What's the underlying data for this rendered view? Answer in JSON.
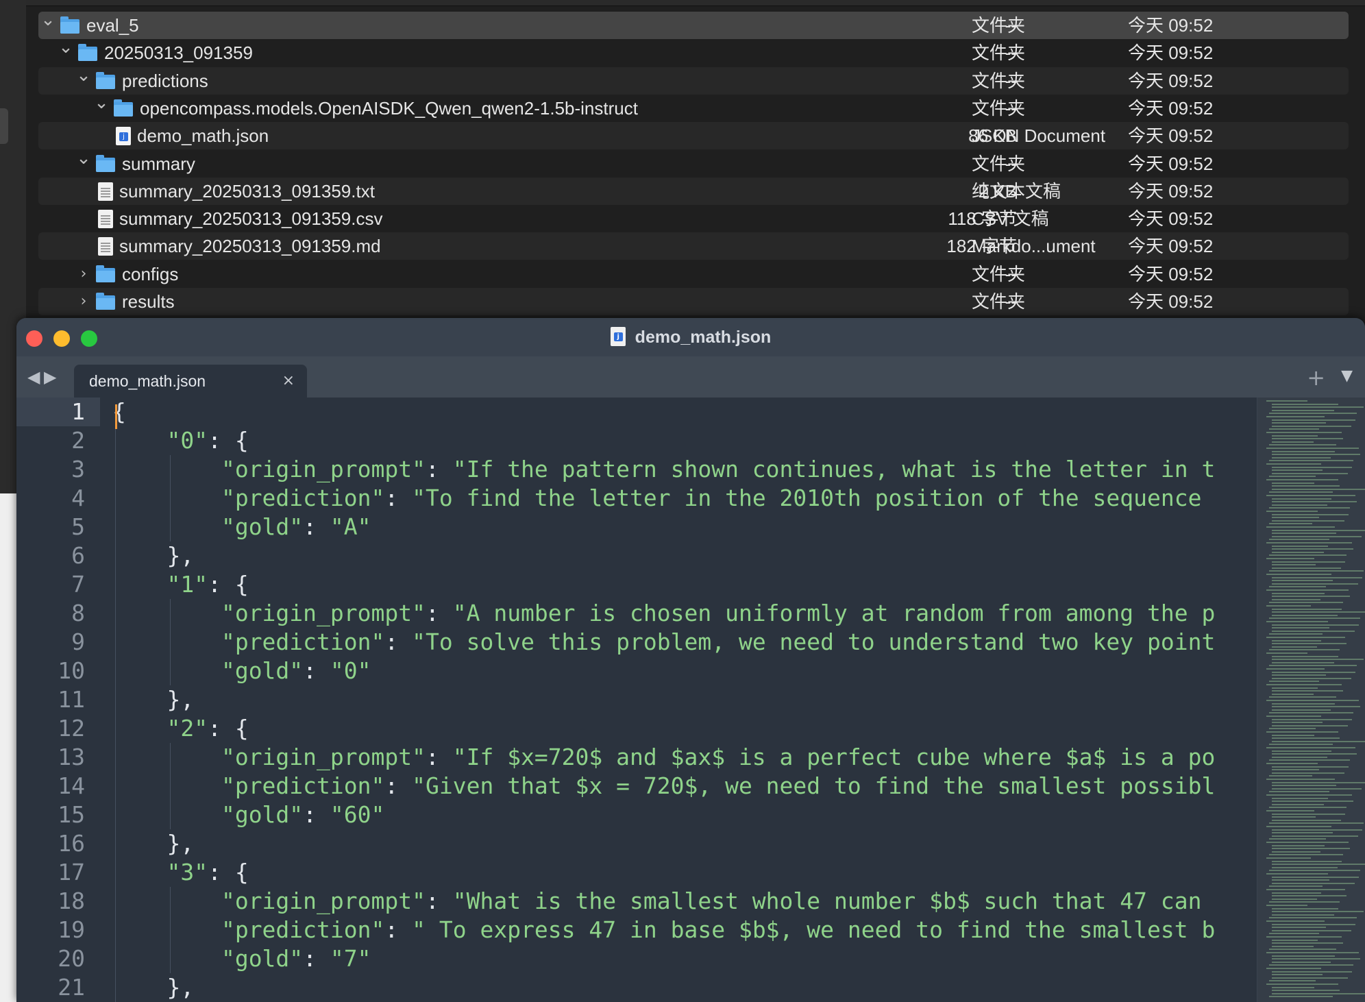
{
  "finder": {
    "rows": [
      {
        "name": "eval_5",
        "size": "--",
        "kind": "文件夹",
        "date": "今天 09:52",
        "depth": 0,
        "type": "folder",
        "expanded": true,
        "selected": true
      },
      {
        "name": "20250313_091359",
        "size": "--",
        "kind": "文件夹",
        "date": "今天 09:52",
        "depth": 1,
        "type": "folder",
        "expanded": true
      },
      {
        "name": "predictions",
        "size": "--",
        "kind": "文件夹",
        "date": "今天 09:52",
        "depth": 2,
        "type": "folder",
        "expanded": true
      },
      {
        "name": "opencompass.models.OpenAISDK_Qwen_qwen2-1.5b-instruct",
        "size": "--",
        "kind": "文件夹",
        "date": "今天 09:52",
        "depth": 3,
        "type": "folder",
        "expanded": true
      },
      {
        "name": "demo_math.json",
        "size": "86 KB",
        "kind": "JSON Document",
        "date": "今天 09:52",
        "depth": 4,
        "type": "json"
      },
      {
        "name": "summary",
        "size": "--",
        "kind": "文件夹",
        "date": "今天 09:52",
        "depth": 2,
        "type": "folder",
        "expanded": true
      },
      {
        "name": "summary_20250313_091359.txt",
        "size": "2 KB",
        "kind": "纯文本文稿",
        "date": "今天 09:52",
        "depth": 3,
        "type": "doc"
      },
      {
        "name": "summary_20250313_091359.csv",
        "size": "118 字节",
        "kind": "CSV 文稿",
        "date": "今天 09:52",
        "depth": 3,
        "type": "doc"
      },
      {
        "name": "summary_20250313_091359.md",
        "size": "182 字节",
        "kind": "Markdo...ument",
        "date": "今天 09:52",
        "depth": 3,
        "type": "doc"
      },
      {
        "name": "configs",
        "size": "--",
        "kind": "文件夹",
        "date": "今天 09:52",
        "depth": 2,
        "type": "folder",
        "expanded": false
      },
      {
        "name": "results",
        "size": "--",
        "kind": "文件夹",
        "date": "今天 09:52",
        "depth": 2,
        "type": "folder",
        "expanded": false
      }
    ]
  },
  "editor": {
    "title": "demo_math.json",
    "tab_label": "demo_math.json",
    "tab_close": "×",
    "back_arrow": "◀",
    "forward_arrow": "▶",
    "new_tab": "+",
    "tab_menu": "▼",
    "current_line": 1,
    "lines": [
      "{",
      "    \"0\": {",
      "        \"origin_prompt\": \"If the pattern shown continues, what is the letter in t",
      "        \"prediction\": \"To find the letter in the 2010th position of the sequence ",
      "        \"gold\": \"A\"",
      "    },",
      "    \"1\": {",
      "        \"origin_prompt\": \"A number is chosen uniformly at random from among the p",
      "        \"prediction\": \"To solve this problem, we need to understand two key point",
      "        \"gold\": \"0\"",
      "    },",
      "    \"2\": {",
      "        \"origin_prompt\": \"If $x=720$ and $ax$ is a perfect cube where $a$ is a po",
      "        \"prediction\": \"Given that $x = 720$, we need to find the smallest possibl",
      "        \"gold\": \"60\"",
      "    },",
      "    \"3\": {",
      "        \"origin_prompt\": \"What is the smallest whole number $b$ such that 47 can ",
      "        \"prediction\": \" To express 47 in base $b$, we need to find the smallest b",
      "        \"gold\": \"7\"",
      "    },"
    ]
  },
  "colors": {
    "string": "#8fd38a",
    "punct": "#e3e7ec",
    "folder": "#4ea1e6",
    "cursor": "#f39a3c"
  },
  "icons": {
    "folder": "folder-icon",
    "json": "json-file-icon",
    "doc": "text-file-icon",
    "chevron_open": "chevron-down-icon",
    "chevron_closed": "chevron-right-icon"
  }
}
